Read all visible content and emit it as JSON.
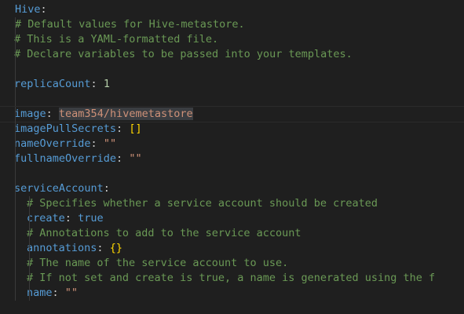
{
  "editor": {
    "lines": [
      {
        "key": "Hive",
        "sep": ":"
      },
      {
        "comment": "# Default values for Hive-metastore."
      },
      {
        "comment": "# This is a YAML-formatted file."
      },
      {
        "comment": "# Declare variables to be passed into your templates."
      },
      {},
      {
        "key": "replicaCount",
        "sep": ":",
        "value": "1"
      },
      {},
      {
        "key": "image",
        "sep": ":",
        "value": "team354/hivemetastore"
      },
      {
        "key": "imagePullSecrets",
        "sep": ":",
        "value": "[]"
      },
      {
        "key": "nameOverride",
        "sep": ":",
        "value": "\"\""
      },
      {
        "key": "fullnameOverride",
        "sep": ":",
        "value": "\"\""
      },
      {},
      {
        "key": "serviceAccount",
        "sep": ":"
      },
      {
        "comment": "# Specifies whether a service account should be created"
      },
      {
        "key": "create",
        "sep": ":",
        "value": "true"
      },
      {
        "comment": "# Annotations to add to the service account"
      },
      {
        "key": "annotations",
        "sep": ":",
        "value": "{}"
      },
      {
        "comment": "# The name of the service account to use."
      },
      {
        "comment": "# If not set and create is true, a name is generated using the f"
      },
      {
        "key": "name",
        "sep": ":",
        "value": "\"\""
      }
    ]
  },
  "colors": {
    "background": "#1f1f1f",
    "key": "#569cd6",
    "comment": "#6a9955",
    "string": "#ce9178",
    "number": "#b5cea8",
    "bracket": "#ffd700"
  }
}
